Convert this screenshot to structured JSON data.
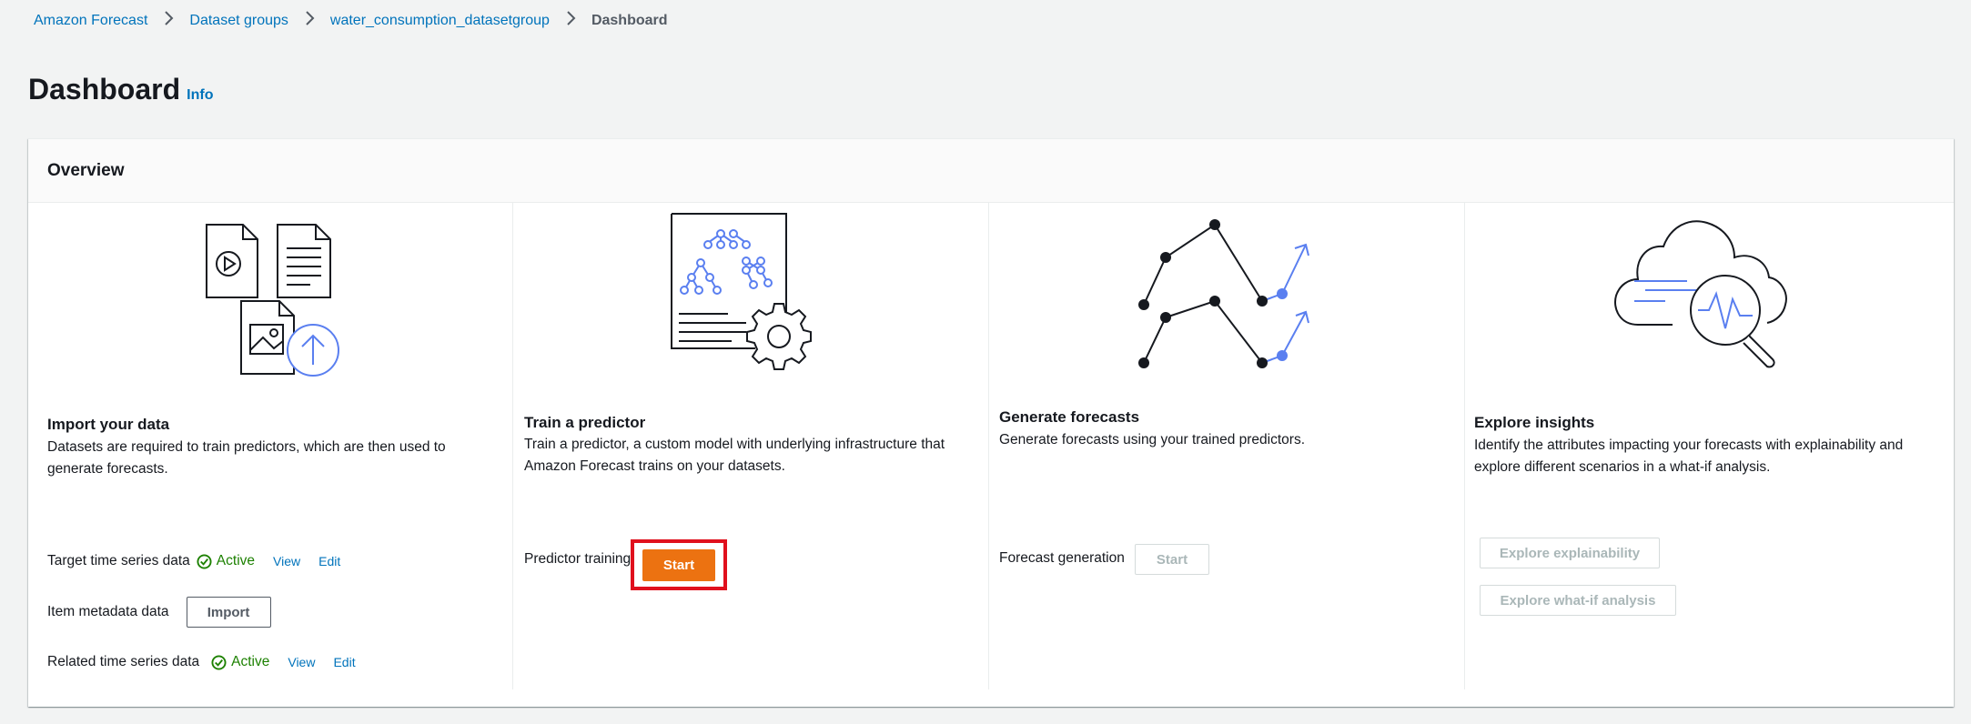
{
  "breadcrumb": {
    "items": [
      "Amazon Forecast",
      "Dataset groups",
      "water_consumption_datasetgroup"
    ],
    "current": "Dashboard"
  },
  "page": {
    "title": "Dashboard",
    "info": "Info"
  },
  "overview": {
    "title": "Overview",
    "import": {
      "title": "Import your data",
      "desc": "Datasets are required to train predictors, which are then used to generate forecasts.",
      "target_label": "Target time series data",
      "target_status": "Active",
      "target_view": "View",
      "target_edit": "Edit",
      "item_label": "Item metadata data",
      "item_button": "Import",
      "related_label": "Related time series data",
      "related_status": "Active",
      "related_view": "View",
      "related_edit": "Edit"
    },
    "train": {
      "title": "Train a predictor",
      "desc": "Train a predictor, a custom model with underlying infrastructure that Amazon Forecast trains on your datasets.",
      "label": "Predictor training",
      "button": "Start"
    },
    "generate": {
      "title": "Generate forecasts",
      "desc": "Generate forecasts using your trained predictors.",
      "label": "Forecast generation",
      "button": "Start"
    },
    "explore": {
      "title": "Explore insights",
      "desc": "Identify the attributes impacting your forecasts with explainability and explore different scenarios in a what-if analysis.",
      "explainability_button": "Explore explainability",
      "whatif_button": "Explore what-if analysis"
    }
  },
  "colors": {
    "link": "#0073bb",
    "primary": "#ec7211",
    "active": "#1d8102",
    "highlight": "#e0101d",
    "accent_blue": "#5a7ff0"
  }
}
